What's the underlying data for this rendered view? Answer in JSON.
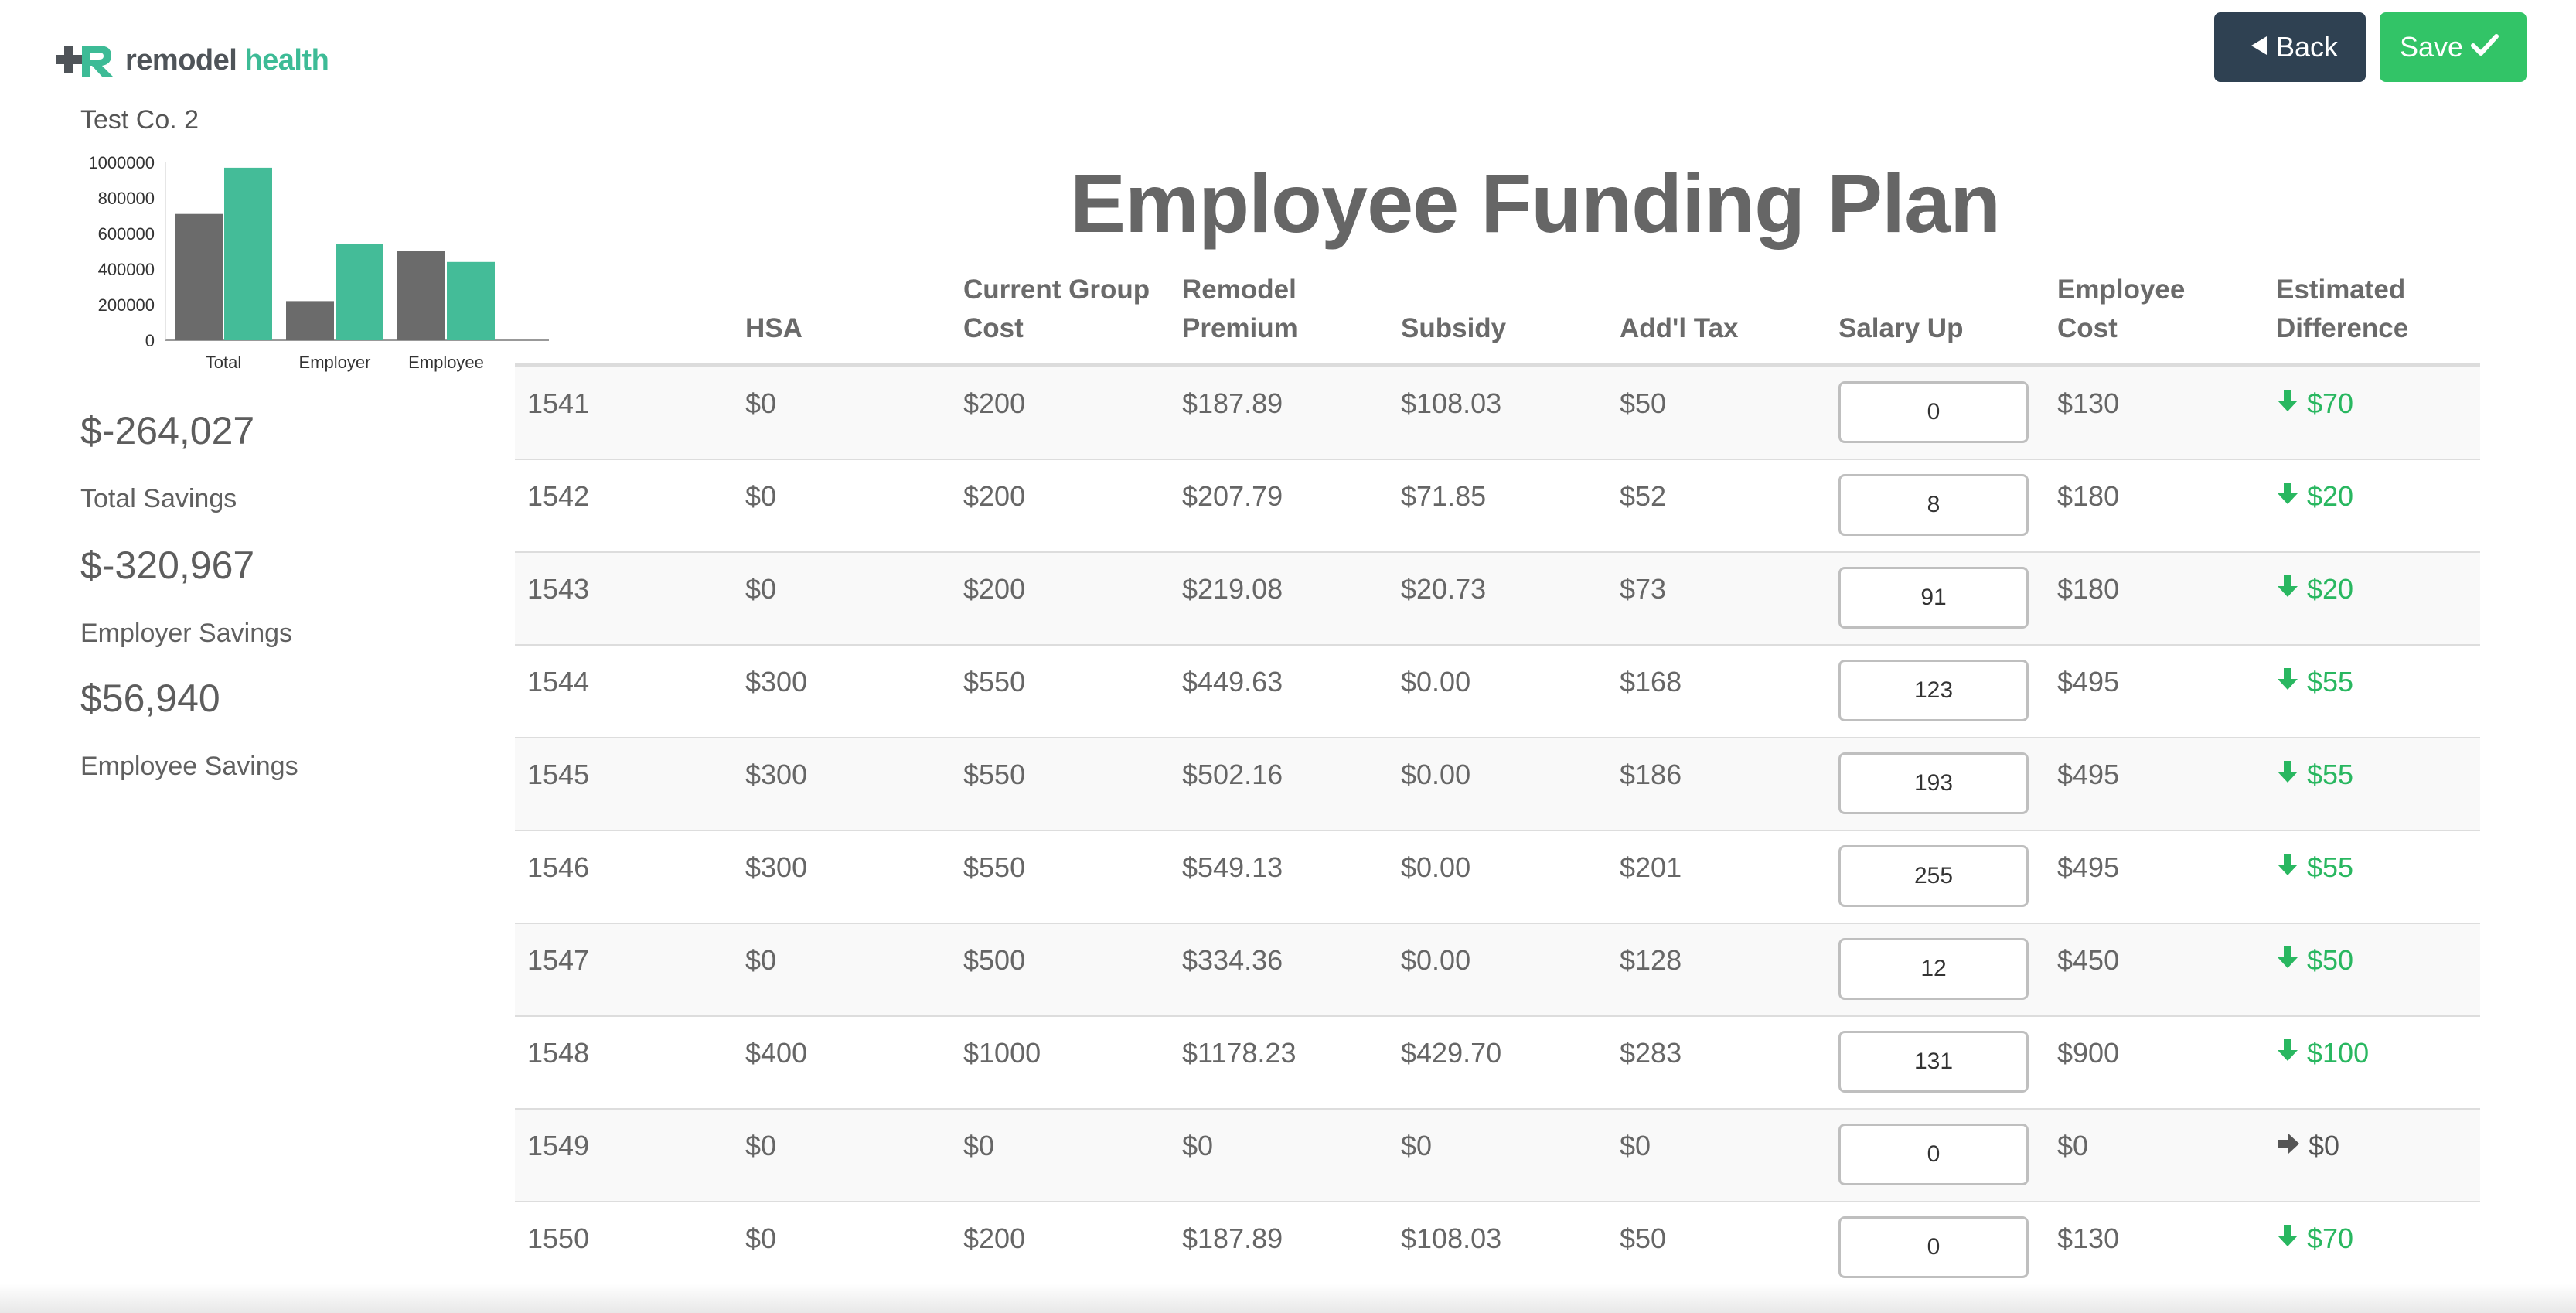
{
  "brand": {
    "name_part1": "remodel",
    "name_part2": "health"
  },
  "company": "Test Co. 2",
  "chart_data": {
    "type": "bar",
    "categories": [
      "Total",
      "Employer",
      "Employee"
    ],
    "series": [
      {
        "values": [
          710000,
          220000,
          500000
        ],
        "color": "#6b6b6b"
      },
      {
        "values": [
          970000,
          540000,
          440000
        ],
        "color": "#44bc98"
      }
    ],
    "yticks": [
      "1000000",
      "800000",
      "600000",
      "400000",
      "200000",
      "0"
    ],
    "ylim": [
      0,
      1000000
    ]
  },
  "stats": [
    {
      "value": "$-264,027",
      "label": "Total Savings"
    },
    {
      "value": "$-320,967",
      "label": "Employer Savings"
    },
    {
      "value": "$56,940",
      "label": "Employee Savings"
    }
  ],
  "title": "Employee Funding Plan",
  "buttons": {
    "back": "Back",
    "save": "Save"
  },
  "table": {
    "headers": [
      "",
      "HSA",
      "Current Group Cost",
      "Remodel Premium",
      "Subsidy",
      "Add'l Tax",
      "Salary Up",
      "Employee Cost",
      "Estimated Difference"
    ],
    "rows": [
      {
        "id": "1541",
        "hsa": "$0",
        "current": "$200",
        "premium": "$187.89",
        "subsidy": "$108.03",
        "tax": "$50",
        "salary": "0",
        "cost": "$130",
        "diff": "$70",
        "dir": "down"
      },
      {
        "id": "1542",
        "hsa": "$0",
        "current": "$200",
        "premium": "$207.79",
        "subsidy": "$71.85",
        "tax": "$52",
        "salary": "8",
        "cost": "$180",
        "diff": "$20",
        "dir": "down"
      },
      {
        "id": "1543",
        "hsa": "$0",
        "current": "$200",
        "premium": "$219.08",
        "subsidy": "$20.73",
        "tax": "$73",
        "salary": "91",
        "cost": "$180",
        "diff": "$20",
        "dir": "down"
      },
      {
        "id": "1544",
        "hsa": "$300",
        "current": "$550",
        "premium": "$449.63",
        "subsidy": "$0.00",
        "tax": "$168",
        "salary": "123",
        "cost": "$495",
        "diff": "$55",
        "dir": "down"
      },
      {
        "id": "1545",
        "hsa": "$300",
        "current": "$550",
        "premium": "$502.16",
        "subsidy": "$0.00",
        "tax": "$186",
        "salary": "193",
        "cost": "$495",
        "diff": "$55",
        "dir": "down"
      },
      {
        "id": "1546",
        "hsa": "$300",
        "current": "$550",
        "premium": "$549.13",
        "subsidy": "$0.00",
        "tax": "$201",
        "salary": "255",
        "cost": "$495",
        "diff": "$55",
        "dir": "down"
      },
      {
        "id": "1547",
        "hsa": "$0",
        "current": "$500",
        "premium": "$334.36",
        "subsidy": "$0.00",
        "tax": "$128",
        "salary": "12",
        "cost": "$450",
        "diff": "$50",
        "dir": "down"
      },
      {
        "id": "1548",
        "hsa": "$400",
        "current": "$1000",
        "premium": "$1178.23",
        "subsidy": "$429.70",
        "tax": "$283",
        "salary": "131",
        "cost": "$900",
        "diff": "$100",
        "dir": "down"
      },
      {
        "id": "1549",
        "hsa": "$0",
        "current": "$0",
        "premium": "$0",
        "subsidy": "$0",
        "tax": "$0",
        "salary": "0",
        "cost": "$0",
        "diff": "$0",
        "dir": "flat"
      },
      {
        "id": "1550",
        "hsa": "$0",
        "current": "$200",
        "premium": "$187.89",
        "subsidy": "$108.03",
        "tax": "$50",
        "salary": "0",
        "cost": "$130",
        "diff": "$70",
        "dir": "down"
      }
    ]
  }
}
